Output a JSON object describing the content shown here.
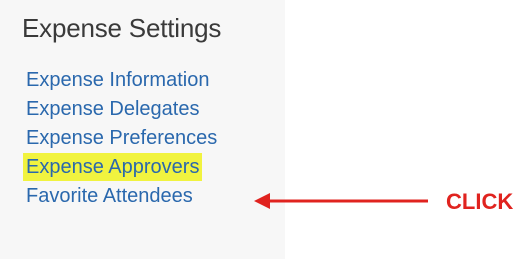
{
  "section": {
    "title": "Expense Settings"
  },
  "menu": {
    "items": [
      {
        "label": "Expense Information"
      },
      {
        "label": "Expense Delegates"
      },
      {
        "label": "Expense Preferences"
      },
      {
        "label": "Expense Approvers"
      },
      {
        "label": "Favorite Attendees"
      }
    ]
  },
  "annotation": {
    "text": "CLICK"
  },
  "colors": {
    "link": "#2a68ad",
    "title": "#3a3a3a",
    "highlight": "#f1f33f",
    "annotation": "#e0231f",
    "panel_background": "#f7f7f7"
  }
}
